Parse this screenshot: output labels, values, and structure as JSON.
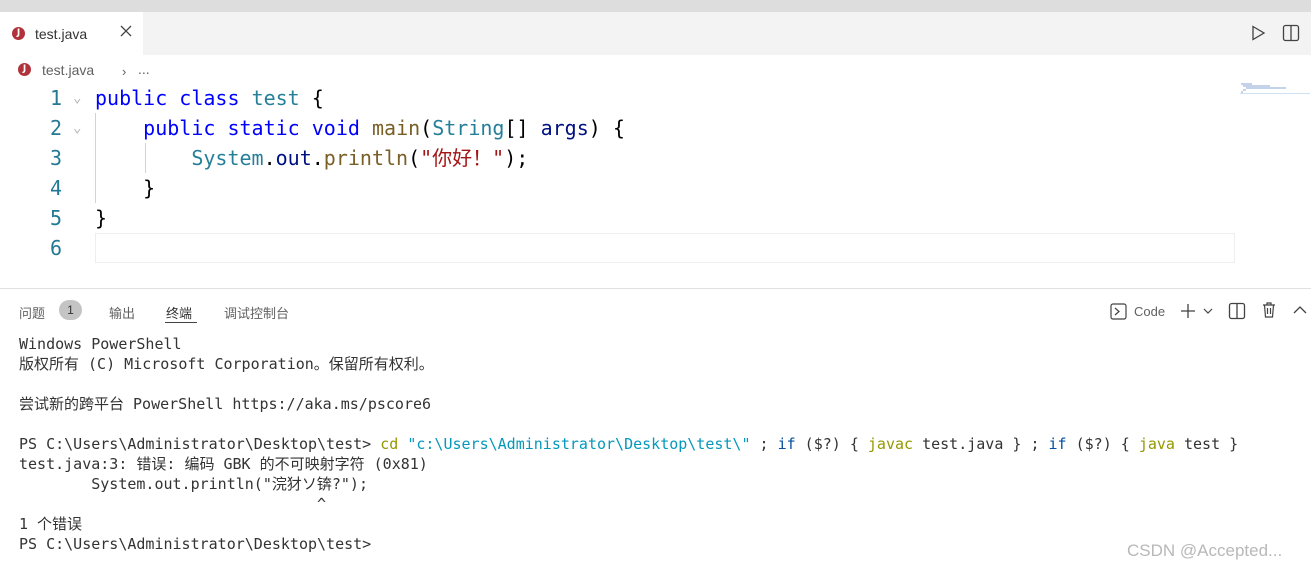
{
  "tab": {
    "file_label": "test.java",
    "icon_letter": "J"
  },
  "breadcrumb": {
    "file": "test.java",
    "separator": "›",
    "more": "..."
  },
  "editor": {
    "lines": [
      {
        "num": "1",
        "parts": [
          [
            "kw",
            "public"
          ],
          [
            "",
            " "
          ],
          [
            "kw",
            "class"
          ],
          [
            "",
            " "
          ],
          [
            "ty",
            "test"
          ],
          [
            "",
            " {"
          ]
        ]
      },
      {
        "num": "2",
        "parts": [
          [
            "",
            "    "
          ],
          [
            "kw",
            "public"
          ],
          [
            "",
            " "
          ],
          [
            "kw",
            "static"
          ],
          [
            "",
            " "
          ],
          [
            "kw",
            "void"
          ],
          [
            "",
            " "
          ],
          [
            "fn",
            "main"
          ],
          [
            "",
            "("
          ],
          [
            "ty",
            "String"
          ],
          [
            "",
            "[] "
          ],
          [
            "kw2",
            "args"
          ],
          [
            "",
            ") {"
          ]
        ]
      },
      {
        "num": "3",
        "parts": [
          [
            "",
            "        "
          ],
          [
            "ty",
            "System"
          ],
          [
            "",
            "."
          ],
          [
            "kw2",
            "out"
          ],
          [
            "",
            "."
          ],
          [
            "fn",
            "println"
          ],
          [
            "",
            "("
          ],
          [
            "str",
            "\"你好！\""
          ],
          [
            "",
            ");"
          ]
        ]
      },
      {
        "num": "4",
        "parts": [
          [
            "",
            "    }"
          ]
        ]
      },
      {
        "num": "5",
        "parts": [
          [
            "",
            "}"
          ]
        ]
      },
      {
        "num": "6",
        "parts": []
      }
    ]
  },
  "panel": {
    "tabs": {
      "problems": "问题",
      "problems_count": "1",
      "output": "输出",
      "terminal": "终端",
      "debug_console": "调试控制台"
    },
    "terminal_label": "Code"
  },
  "terminal": {
    "line1": "Windows PowerShell",
    "line2": "版权所有 (C) Microsoft Corporation。保留所有权利。",
    "line3": "尝试新的跨平台 PowerShell https://aka.ms/pscore6",
    "prompt": "PS C:\\Users\\Administrator\\Desktop\\test> ",
    "cmd_cd": "cd",
    "cmd_path": " \"c:\\Users\\Administrator\\Desktop\\test\\\"",
    "cmd_sep1": " ; ",
    "cmd_if1": "if",
    "cmd_cond1": " ($?) { ",
    "cmd_javac": "javac",
    "cmd_arg1": " test.java } ; ",
    "cmd_if2": "if",
    "cmd_cond2": " ($?) { ",
    "cmd_java": "java",
    "cmd_arg2": " test }",
    "err1": "test.java:3: 错误: 编码 GBK 的不可映射字符 (0x81)",
    "err2": "        System.out.println(\"浣犲ソ锛?\");",
    "err3": "                                 ^",
    "err4": "1 个错误",
    "final_prompt": "PS C:\\Users\\Administrator\\Desktop\\test>"
  },
  "watermark": "CSDN @Accepted..."
}
